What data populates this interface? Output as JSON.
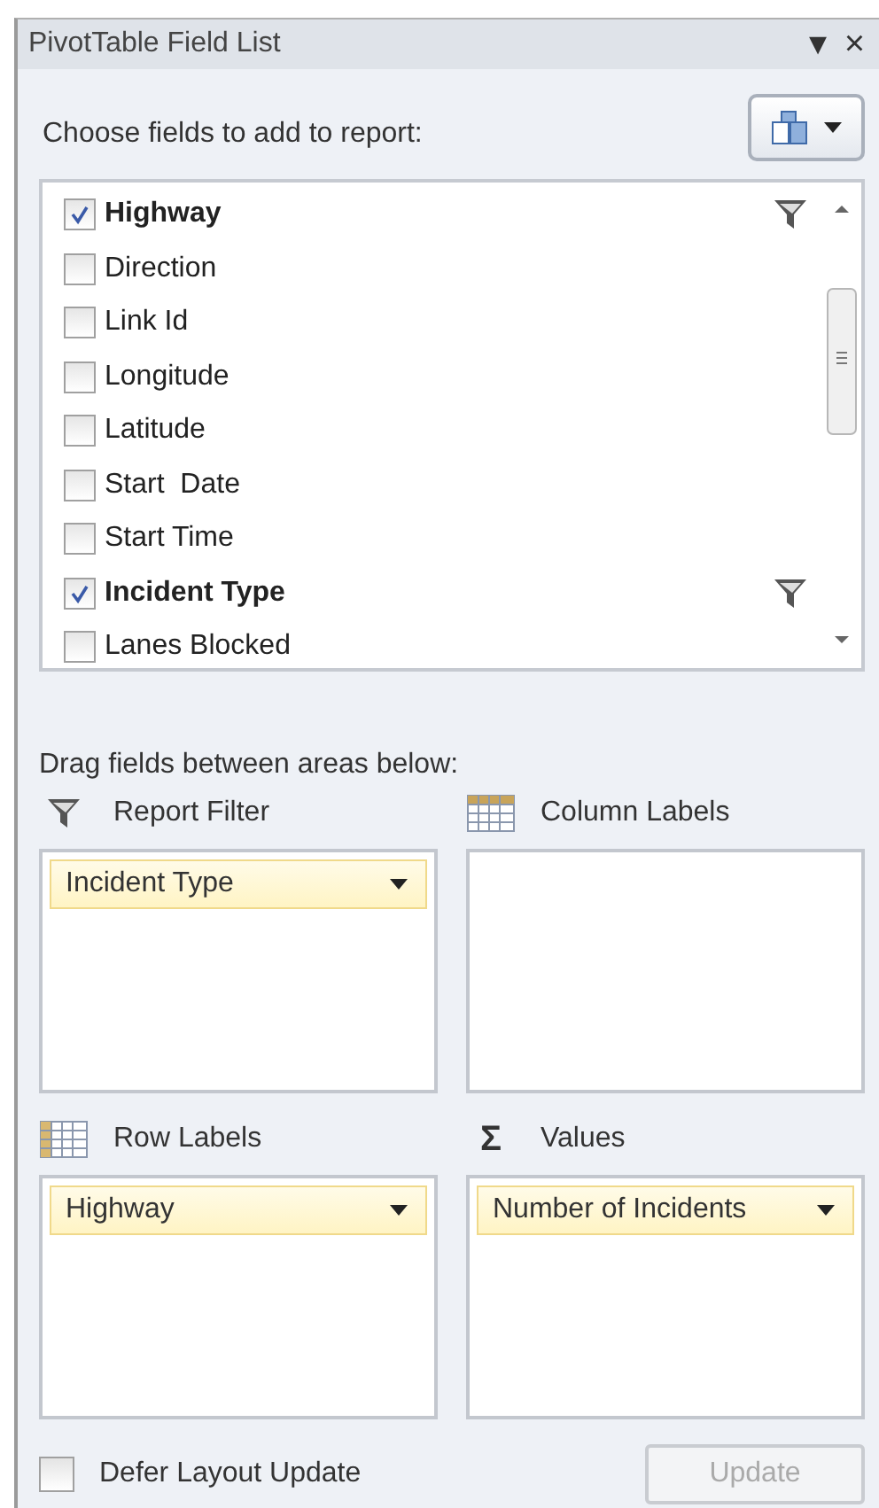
{
  "window": {
    "title": "PivotTable Field List",
    "menu_glyph": "▾",
    "close_glyph": "×"
  },
  "field_section": {
    "label": "Choose fields to add to report:"
  },
  "fields": [
    {
      "label": "Highway",
      "checked": true,
      "filtered": true
    },
    {
      "label": "Direction",
      "checked": false,
      "filtered": false
    },
    {
      "label": "Link Id",
      "checked": false,
      "filtered": false
    },
    {
      "label": "Longitude",
      "checked": false,
      "filtered": false
    },
    {
      "label": "Latitude",
      "checked": false,
      "filtered": false
    },
    {
      "label": "Start  Date",
      "checked": false,
      "filtered": false
    },
    {
      "label": "Start Time",
      "checked": false,
      "filtered": false
    },
    {
      "label": "Incident Type",
      "checked": true,
      "filtered": true
    },
    {
      "label": "Lanes Blocked",
      "checked": false,
      "filtered": false
    }
  ],
  "areas_section": {
    "label": "Drag fields between areas below:"
  },
  "areas": [
    {
      "kind": "filter",
      "label": "Report Filter",
      "items": [
        "Incident Type"
      ]
    },
    {
      "kind": "columns",
      "label": "Column Labels"
    },
    {
      "kind": "rows",
      "label": "Row Labels",
      "items": [
        "Highway"
      ]
    },
    {
      "kind": "values",
      "label": "Values",
      "glyph": "Σ",
      "items": [
        "Number of Incidents"
      ]
    }
  ],
  "defer": {
    "label": "Defer Layout Update",
    "checked": false
  },
  "update_button": {
    "label": "Update",
    "disabled": true
  }
}
